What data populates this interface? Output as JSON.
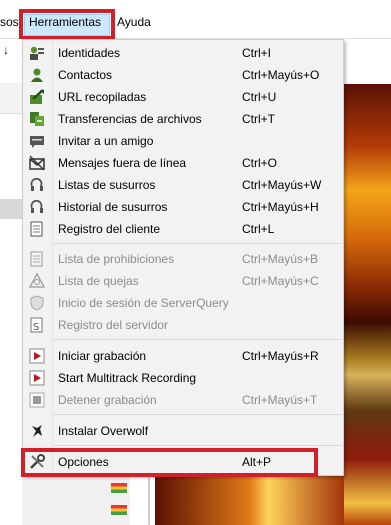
{
  "menubar": {
    "partial_item": "sos",
    "tools_label": "Herramientas",
    "help_label": "Ayuda"
  },
  "left_panel": {
    "tool_glyph": "↓"
  },
  "menu": {
    "items": [
      {
        "label": "Identidades",
        "shortcut": "Ctrl+I",
        "icon": "identities-icon",
        "enabled": true
      },
      {
        "label": "Contactos",
        "shortcut": "Ctrl+Mayús+O",
        "icon": "contacts-icon",
        "enabled": true
      },
      {
        "label": "URL recopiladas",
        "shortcut": "Ctrl+U",
        "icon": "url-catcher-icon",
        "enabled": true
      },
      {
        "label": "Transferencias de archivos",
        "shortcut": "Ctrl+T",
        "icon": "file-transfer-icon",
        "enabled": true
      },
      {
        "label": "Invitar a un amigo",
        "shortcut": "",
        "icon": "invite-friend-icon",
        "enabled": true
      },
      {
        "label": "Mensajes fuera de línea",
        "shortcut": "Ctrl+O",
        "icon": "offline-messages-icon",
        "enabled": true
      },
      {
        "label": "Listas de susurros",
        "shortcut": "Ctrl+Mayús+W",
        "icon": "whisper-lists-icon",
        "enabled": true
      },
      {
        "label": "Historial de susurros",
        "shortcut": "Ctrl+Mayús+H",
        "icon": "whisper-history-icon",
        "enabled": true
      },
      {
        "label": "Registro del cliente",
        "shortcut": "Ctrl+L",
        "icon": "client-log-icon",
        "enabled": true
      },
      {
        "label": "Lista de prohibiciones",
        "shortcut": "Ctrl+Mayús+B",
        "icon": "ban-list-icon",
        "enabled": false
      },
      {
        "label": "Lista de quejas",
        "shortcut": "Ctrl+Mayús+C",
        "icon": "complaint-list-icon",
        "enabled": false
      },
      {
        "label": "Inicio de sesión de ServerQuery",
        "shortcut": "",
        "icon": "serverquery-login-icon",
        "enabled": false
      },
      {
        "label": "Registro del servidor",
        "shortcut": "",
        "icon": "server-log-icon",
        "enabled": false
      },
      {
        "label": "Iniciar grabación",
        "shortcut": "Ctrl+Mayús+R",
        "icon": "record-icon",
        "enabled": true
      },
      {
        "label": "Start Multitrack Recording",
        "shortcut": "",
        "icon": "multitrack-record-icon",
        "enabled": true
      },
      {
        "label": "Detener grabación",
        "shortcut": "Ctrl+Mayús+T",
        "icon": "stop-record-icon",
        "enabled": false
      },
      {
        "label": "Instalar Overwolf",
        "shortcut": "",
        "icon": "overwolf-icon",
        "enabled": true
      },
      {
        "label": "Opciones",
        "shortcut": "Alt+P",
        "icon": "options-icon",
        "enabled": true
      }
    ]
  },
  "colors": {
    "highlight_border": "#d0202a",
    "menu_background": "#f2f2f2",
    "disabled_text": "#8c8c8c"
  }
}
